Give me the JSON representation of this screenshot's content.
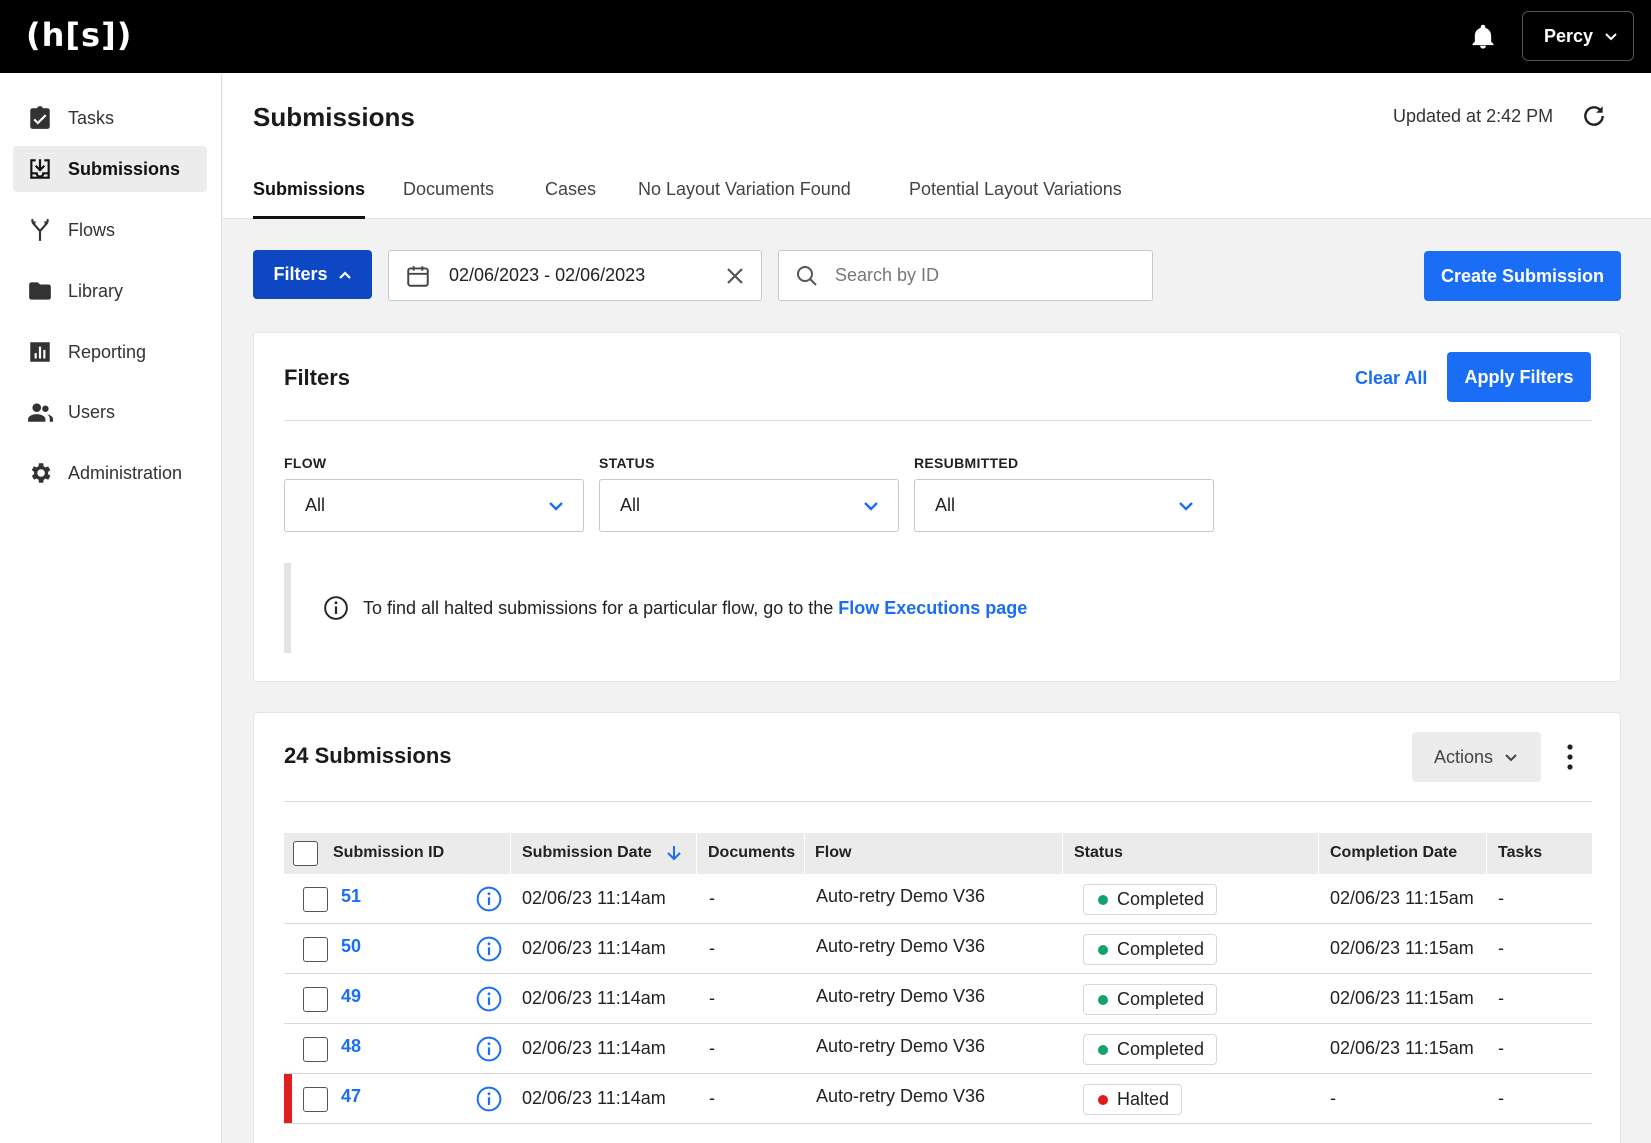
{
  "app": {
    "logo": "(h[s])",
    "user": "Percy"
  },
  "sidebar": {
    "items": [
      {
        "label": "Tasks",
        "icon": "clipboard-check-icon"
      },
      {
        "label": "Submissions",
        "icon": "inbox-download-icon",
        "active": true
      },
      {
        "label": "Flows",
        "icon": "flow-branch-icon"
      },
      {
        "label": "Library",
        "icon": "folder-icon"
      },
      {
        "label": "Reporting",
        "icon": "bar-chart-icon"
      },
      {
        "label": "Users",
        "icon": "users-icon"
      },
      {
        "label": "Administration",
        "icon": "gear-icon"
      }
    ]
  },
  "header": {
    "title": "Submissions",
    "updated": "Updated at 2:42 PM",
    "tabs": [
      "Submissions",
      "Documents",
      "Cases",
      "No Layout Variation Found",
      "Potential Layout Variations"
    ]
  },
  "toolbar": {
    "filters_label": "Filters",
    "date_range": "02/06/2023 - 02/06/2023",
    "search_placeholder": "Search by ID",
    "create_label": "Create Submission"
  },
  "filters": {
    "title": "Filters",
    "clear_label": "Clear All",
    "apply_label": "Apply Filters",
    "fields": [
      {
        "label": "FLOW",
        "value": "All"
      },
      {
        "label": "STATUS",
        "value": "All"
      },
      {
        "label": "RESUBMITTED",
        "value": "All"
      }
    ],
    "notice_text": "To find all halted submissions for a particular flow, go to the",
    "notice_link": "Flow Executions page"
  },
  "submissions": {
    "title": "24 Submissions",
    "actions_label": "Actions",
    "columns": [
      "Submission ID",
      "Submission Date",
      "Documents",
      "Flow",
      "Status",
      "Completion Date",
      "Tasks"
    ],
    "status_colors": {
      "Completed": "#12a36a",
      "Halted": "#e01b1b"
    },
    "rows": [
      {
        "id": "51",
        "date": "02/06/23 11:14am",
        "documents": "-",
        "flow": "Auto-retry Demo V36",
        "status": "Completed",
        "completion": "02/06/23 11:15am",
        "tasks": "-"
      },
      {
        "id": "50",
        "date": "02/06/23 11:14am",
        "documents": "-",
        "flow": "Auto-retry Demo V36",
        "status": "Completed",
        "completion": "02/06/23 11:15am",
        "tasks": "-"
      },
      {
        "id": "49",
        "date": "02/06/23 11:14am",
        "documents": "-",
        "flow": "Auto-retry Demo V36",
        "status": "Completed",
        "completion": "02/06/23 11:15am",
        "tasks": "-"
      },
      {
        "id": "48",
        "date": "02/06/23 11:14am",
        "documents": "-",
        "flow": "Auto-retry Demo V36",
        "status": "Completed",
        "completion": "02/06/23 11:15am",
        "tasks": "-"
      },
      {
        "id": "47",
        "date": "02/06/23 11:14am",
        "documents": "-",
        "flow": "Auto-retry Demo V36",
        "status": "Halted",
        "completion": "-",
        "tasks": "-"
      }
    ]
  }
}
